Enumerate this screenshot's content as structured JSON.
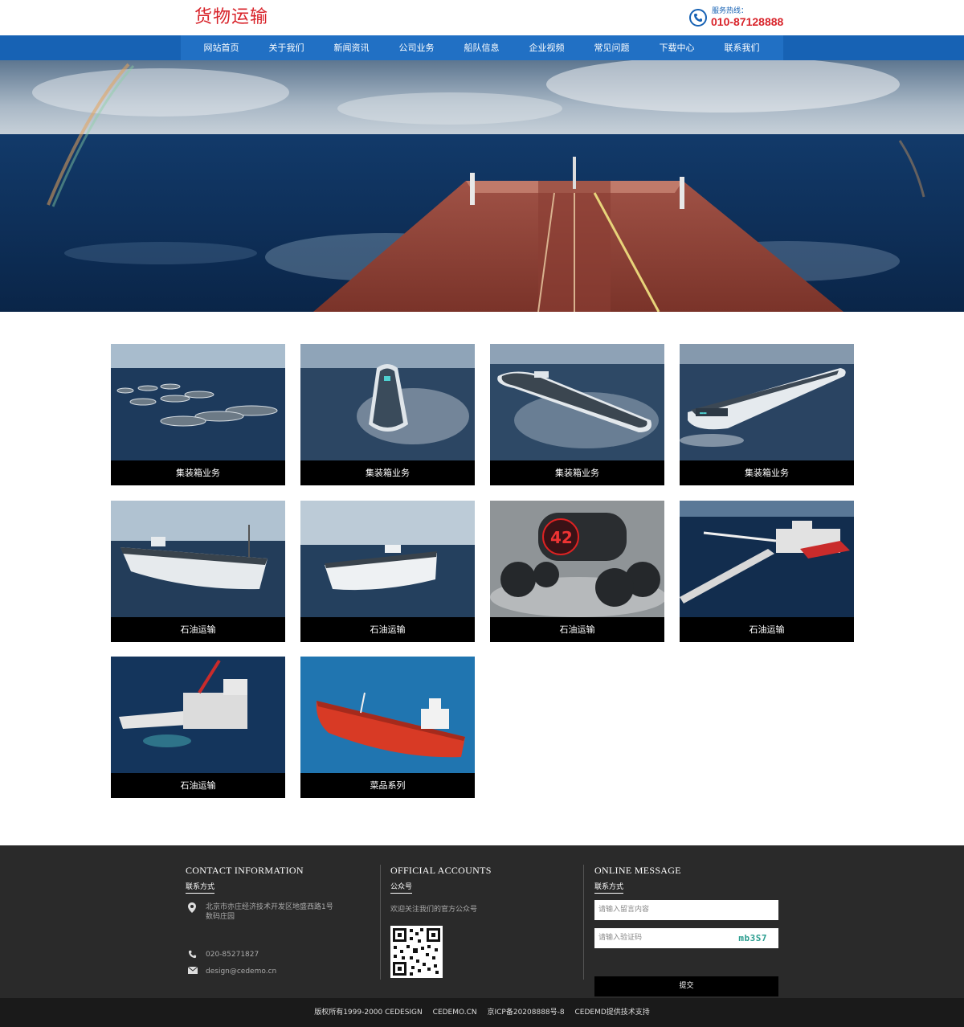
{
  "header": {
    "logo_text": "货物运输",
    "hotline_label": "服务热线：",
    "hotline_number": "010-87128888"
  },
  "nav": {
    "items": [
      "网站首页",
      "关于我们",
      "新闻资讯",
      "公司业务",
      "船队信息",
      "企业视频",
      "常见问题",
      "下载中心",
      "联系我们"
    ]
  },
  "products": [
    {
      "label": "集装箱业务",
      "image": "fleet-of-vessels"
    },
    {
      "label": "集装箱业务",
      "image": "vessel-top-view"
    },
    {
      "label": "集装箱业务",
      "image": "vessel-angled-view"
    },
    {
      "label": "集装箱业务",
      "image": "vessel-side-view"
    },
    {
      "label": "石油运输",
      "image": "white-hull-ship"
    },
    {
      "label": "石油运输",
      "image": "white-hull-ship-front"
    },
    {
      "label": "石油运输",
      "image": "robot-vehicle"
    },
    {
      "label": "石油运输",
      "image": "pipe-laying-vessel"
    },
    {
      "label": "石油运输",
      "image": "crane-vessel"
    },
    {
      "label": "菜品系列",
      "image": "red-oil-tanker"
    }
  ],
  "footer": {
    "contact": {
      "title": "CONTACT INFORMATION",
      "subtitle": "联系方式",
      "address": "北京市亦庄经济技术开发区地盛西路1号数码庄园",
      "phone": "020-85271827",
      "email": "design@cedemo.cn"
    },
    "official": {
      "title": "OFFICIAL ACCOUNTS",
      "subtitle": "公众号",
      "welcome": "欢迎关注我们的官方公众号"
    },
    "message": {
      "title": "ONLINE MESSAGE",
      "subtitle": "联系方式",
      "content_placeholder": "请输入留言内容",
      "captcha_placeholder": "请输入验证码",
      "captcha_code": "mb3S7",
      "submit_label": "提交"
    }
  },
  "copyright": {
    "text": "版权所有1999-2000 CEDESIGN",
    "domain": "CEDEMO.CN",
    "icp": "京ICP备20208888号-8",
    "support": "CEDEMD提供技术支持"
  },
  "colors": {
    "brand_red": "#d8232a",
    "nav_blue": "#1762b4",
    "footer_bg": "#2a2a2a"
  }
}
